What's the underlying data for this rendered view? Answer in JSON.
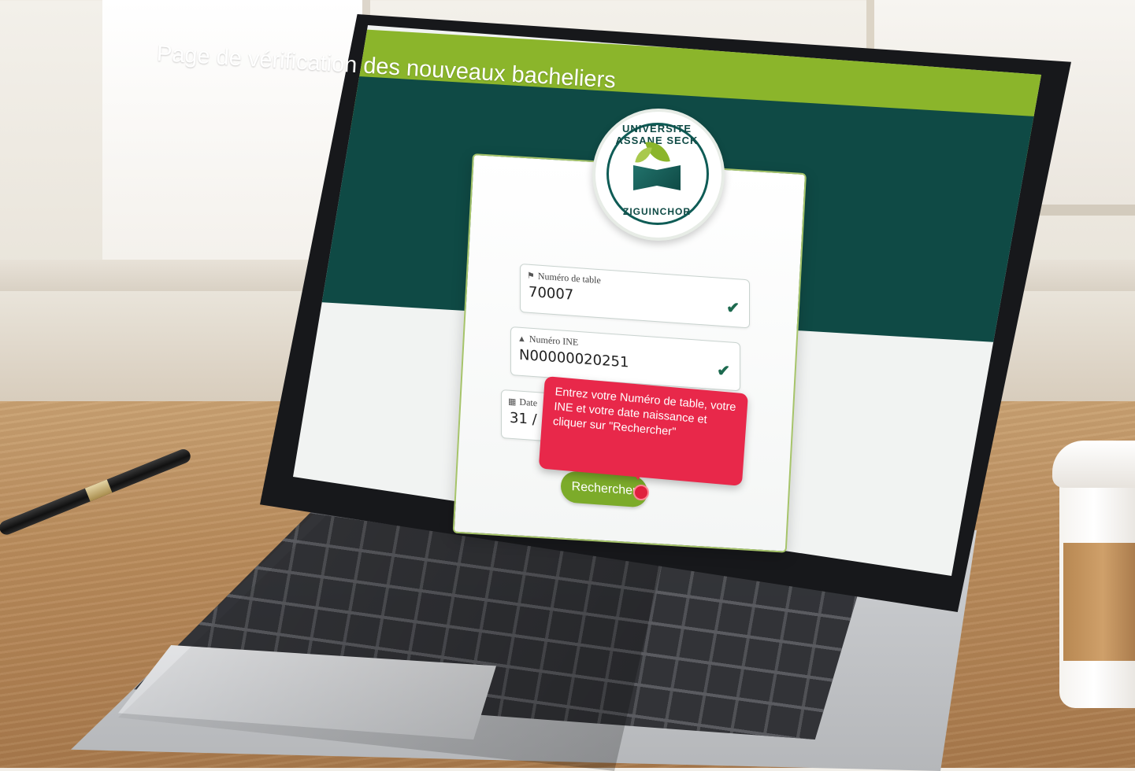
{
  "banner": {
    "title": "Page de vérification des nouveaux bacheliers"
  },
  "logo": {
    "top_text": "UNIVERSITE ASSANE SECK",
    "bottom_text": "ZIGUINCHOR"
  },
  "form": {
    "fields": [
      {
        "label": "Numéro de table",
        "value": "70007",
        "icon": "tag-icon",
        "valid": true
      },
      {
        "label": "Numéro INE",
        "value": "N00000020251",
        "icon": "graduation-cap-icon",
        "valid": true
      },
      {
        "label": "Date",
        "value": "31 / 1",
        "icon": "calendar-icon",
        "valid": false
      }
    ],
    "search_label": "Rechercher"
  },
  "tooltip": {
    "text": "Entrez votre Numéro de table, votre INE et votre date naissance et cliquer sur \"Rechercher\""
  },
  "colors": {
    "banner_green": "#8bb52b",
    "dark_teal": "#0f4a45",
    "tooltip_red": "#e8284a",
    "button_green": "#7cab2a"
  }
}
